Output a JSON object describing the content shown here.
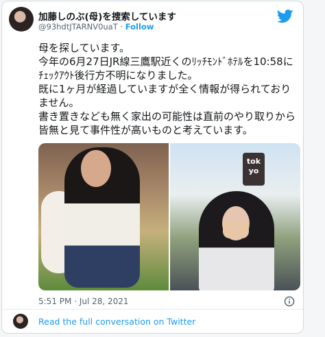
{
  "tweet": {
    "author_name": "加藤しのぶ(母)を捜索しています",
    "author_handle": "@93hdtJTARNV0uaT",
    "separator": "·",
    "follow_label": "Follow",
    "text_lines": [
      "母を探しています。",
      "今年の6月27日JR線三鷹駅近くのﾘｯﾁﾓﾝﾄﾞﾎﾃﾙを10:58にﾁｪｯｸｱｳﾄ後行方不明になりました。",
      "既に1ヶ月が経過していますが全く情報が得られておりません。",
      "書き置きなども無く家出の可能性は直前のやり取りから皆無と見て事件性が高いものと考えています。"
    ],
    "photo_sign_text": "tok\nyo",
    "timestamp": "5:51 PM · Jul 28, 2021",
    "read_more_label": "Read the full conversation on Twitter"
  },
  "colors": {
    "accent": "#1d9bf0",
    "text": "#14171a",
    "muted": "#536471"
  },
  "icons": [
    "twitter-bird-icon",
    "info-icon"
  ]
}
